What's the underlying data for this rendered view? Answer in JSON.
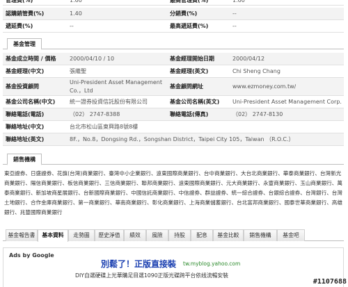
{
  "top_rows": [
    {
      "l1": "管理費(%)",
      "v1": "1.60",
      "l2": "最高管理費(%)",
      "v2": "1.60"
    },
    {
      "l1": "認購銷管費(%)",
      "v1": "1.40",
      "l2": "分銷費(%)",
      "v2": "--"
    },
    {
      "l1": "遞延費(%)",
      "v1": "--",
      "l2": "最高遞延費(%)",
      "v2": "--"
    }
  ],
  "management": {
    "section_title": "基金管理",
    "rows": [
      {
        "l1": "基金成立時間 / 價格",
        "v1": "2000/04/10 / 10",
        "l2": "基金經理開始日期",
        "v2": "2000/04/12"
      },
      {
        "l1": "基金經理(中文)",
        "v1": "張繼聖",
        "l2": "基金經理(英文)",
        "v2": "Chi Sheng Chang"
      },
      {
        "l1": "基金投資顧問",
        "v1": "Uni-President Asset Management",
        "v1b": "Co.，Ltd",
        "l2": "基金顧問網址",
        "v2": "www.ezmoney.com.tw/"
      },
      {
        "l1": "基金公司名稱(中文)",
        "v1": "統一證券投資信託股份有限公司",
        "l2": "基金公司名稱(英文)",
        "v2": "Uni-President Asset Management Corp."
      },
      {
        "l1": "聯絡電話(電話)",
        "v1": "（02） 2747-8388",
        "l2": "聯絡電話(傳真)",
        "v2": "（02） 2747-8130"
      },
      {
        "l1": "聯絡地址(中文)",
        "v1": "台北市松山區東興路8號8樓",
        "l2": "",
        "v2": ""
      },
      {
        "l1": "聯絡地址(英文)",
        "v1": "8F.，No.8，Dongsing Rd.，Songshan District，Taipei City 105，Taiwan （R.O.C.）",
        "l2": "",
        "v2": ""
      }
    ]
  },
  "sales": {
    "section_title": "銷售機構",
    "banks": "東亞證券、日盛證券、花旗(台灣)商業銀行、臺灣中小企業銀行、遠東國際商業銀行、台中商業銀行、大台北商業銀行、華泰商業銀行、台灣新光商業銀行、陽信商業銀行、板信商業銀行、三信商業銀行、聯邦商業銀行、遠東國際商業銀行、元大商業銀行、永豐商業銀行、玉山商業銀行、萬泰商業銀行、新加坡商星展銀行、台新國際商業銀行、中國信託商業銀行、中信證券、群益證券、統一綜合證券、台銀綜合證券、台灣銀行、台灣土地銀行、合作金庫商業銀行、第一商業銀行、華南商業銀行、彰化商業銀行、上海商業儲蓄銀行、台北富邦商業銀行、國泰世華商業銀行、高雄銀行、兆豐國際商業銀行"
  },
  "tabs": [
    "基金報告書",
    "基本資料",
    "走勢圖",
    "歷史淨值",
    "績效",
    "風險",
    "持股",
    "配息",
    "基金比較",
    "銷售機構",
    "基金吧"
  ],
  "active_tab": "基本資料",
  "ads": {
    "label": "Ads by Google",
    "title": "別鬆了！正版直接裝",
    "url": "tw.myblog.yahoo.com",
    "desc": "DIY自選硬碟上光華購足目選1090正版光碟跨平台依线流暢安裝"
  },
  "watermark": "#1107688"
}
